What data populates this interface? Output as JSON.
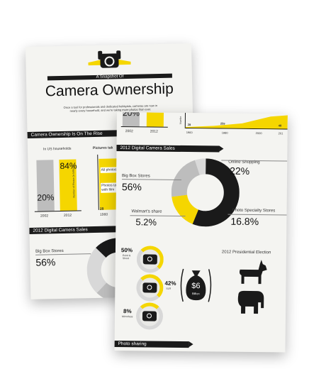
{
  "back": {
    "subtitle": "A Snapshot Of",
    "title": "Camera Ownership",
    "intro": "Once a tool for professionals and dedicated hobbyists, cameras are now in nearly every household, and we're taking more photos than ever.",
    "band_rise": "Camera Ownership Is On The Rise",
    "households_label": "In US households",
    "pictures_label": "Pictures tak",
    "bar_2002_value": "20%",
    "bar_2012_value": "84%",
    "year_2002": "2002",
    "year_2012": "2012",
    "axis_label": "Number of Photos (in billions)",
    "photos_text": "All photos",
    "film_text": "Photos ta with film",
    "mini_value": "28",
    "mini_year": "1960",
    "band_sales": "2012 Digital Camera Sales",
    "big_box_label": "Big Box Stores",
    "big_box_value": "56%"
  },
  "front": {
    "top_value": "20%",
    "top_year_2002": "2002",
    "top_year_2012": "2012",
    "top_axis_label": "Numbe",
    "line_values": [
      "28",
      "259",
      "48"
    ],
    "line_years": [
      "1960",
      "1980",
      "2000",
      "201"
    ],
    "band_sales": "2012 Digital Camera Sales",
    "big_box_label": "Big Box Stores",
    "big_box_value": "56%",
    "walmart_label": "Walmart's share",
    "walmart_value": "5.2%",
    "online_label": "Online Shopping",
    "online_value": "22%",
    "specialty_label": "Photo Specialty Stores",
    "specialty_value": "16.8%",
    "type1_value": "50%",
    "type1_label": "Point & Shoot",
    "type2_value": "42%",
    "type2_label": "SLR",
    "type3_value": "8%",
    "type3_label": "Mirrorless",
    "money_value": "$6",
    "money_unit": "Billion",
    "election_label": "2012 Presidential Election",
    "band_sharing": "Photo sharing"
  },
  "colors": {
    "accent": "#f5d600",
    "dark": "#1a1a1a",
    "gray": "#bdbdbd",
    "paper": "#f4f4f1"
  }
}
